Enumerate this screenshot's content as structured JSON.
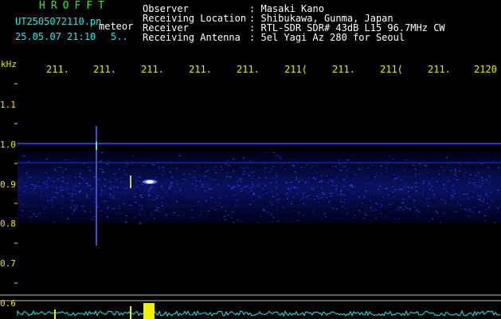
{
  "app": {
    "logo": "HROFFT"
  },
  "file": {
    "name": "UT2505072110.pn",
    "tag": "meteor",
    "datetime": "25.05.07 21:10",
    "extra": "5.."
  },
  "station": {
    "rows": [
      {
        "label": "Observer",
        "sep": ":",
        "value": "Masaki Kano"
      },
      {
        "label": "Receiving Location",
        "sep": ":",
        "value": "Shibukawa, Gunma, Japan"
      },
      {
        "label": "Receiver",
        "sep": ":",
        "value": "RTL-SDR SDR# 43dB L15 96.7MHz CW"
      },
      {
        "label": "Receiving Antenna",
        "sep": ":",
        "value": "5el Yagi Az 280 for Seoul"
      }
    ]
  },
  "axis": {
    "unit": "kHz",
    "x_ticks": [
      "211.",
      "211.",
      "211.",
      "211.",
      "211.",
      "211(",
      "211.",
      "211(",
      "211.",
      "2120"
    ],
    "y_ticks": [
      "1.1",
      "1.0",
      "0.9",
      "0.8",
      "0.7",
      "0.6"
    ]
  },
  "colors": {
    "logo": "#2ee82e",
    "axis_text": "#e8e800",
    "info_text": "#ffffff",
    "file_text": "#27e7e7",
    "band": "#1a2bd8",
    "signal": "#d0d0ff",
    "spectrum": "#27e7e7",
    "spike": "#f0f000"
  }
}
